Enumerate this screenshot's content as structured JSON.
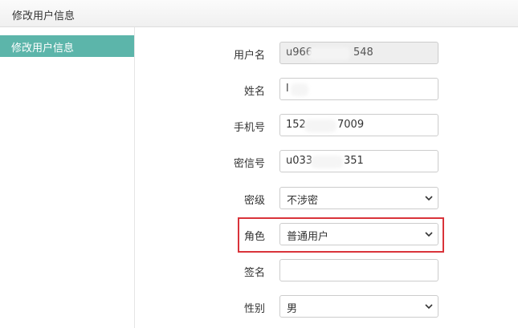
{
  "header": {
    "title": "修改用户信息"
  },
  "sidebar": {
    "items": [
      {
        "label": "修改用户信息"
      }
    ]
  },
  "form": {
    "username": {
      "label": "用户名",
      "value": "u966",
      "value_tail": "548"
    },
    "name": {
      "label": "姓名",
      "value": "l"
    },
    "phone": {
      "label": "手机号",
      "value": "152",
      "value_tail": "7009"
    },
    "secret_no": {
      "label": "密信号",
      "value": "u033",
      "value_tail": "351"
    },
    "level": {
      "label": "密级",
      "selected": "不涉密"
    },
    "role": {
      "label": "角色",
      "selected": "普通用户"
    },
    "signature": {
      "label": "签名",
      "value": ""
    },
    "gender": {
      "label": "性别",
      "selected": "男"
    }
  },
  "colors": {
    "sidebar_active": "#5cb5aa",
    "highlight_border": "#d9333a"
  }
}
